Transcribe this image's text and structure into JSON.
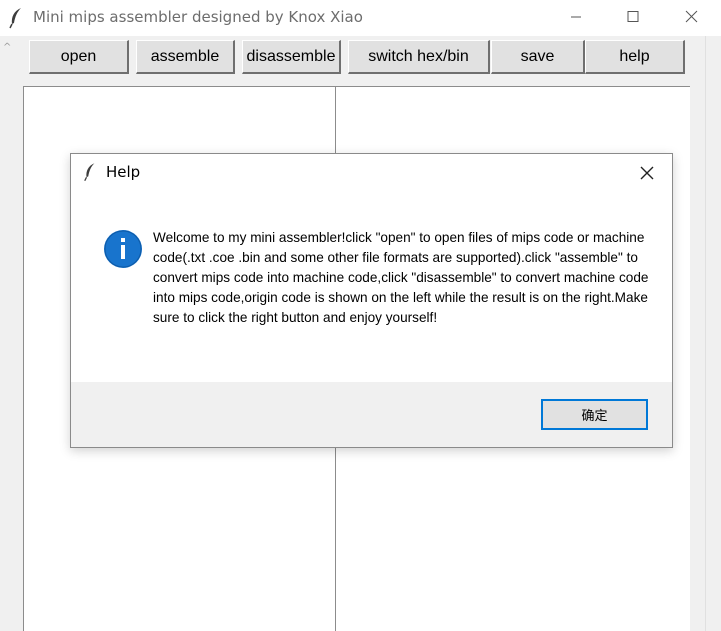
{
  "window": {
    "title": "Mini mips assembler designed by Knox Xiao",
    "controls": {
      "minimize_icon": "minimize-icon",
      "maximize_icon": "maximize-icon",
      "close_icon": "close-icon"
    }
  },
  "toolbar": {
    "open_label": "open",
    "assemble_label": "assemble",
    "disassemble_label": "disassemble",
    "switch_label": "switch hex/bin",
    "save_label": "save",
    "help_label": "help"
  },
  "panes": {
    "left_text": "",
    "right_text": ""
  },
  "dialog": {
    "title": "Help",
    "icon": "info-icon",
    "message": "Welcome to my mini assembler!click \"open\" to open files of mips code or machine code(.txt .coe .bin and some other file formats are supported).click \"assemble\" to convert mips code into machine code,click \"disassemble\" to convert machine code into mips code,origin code is shown on the left while the result is on the right.Make sure to click the right button and enjoy yourself!",
    "ok_label": "确定"
  },
  "colors": {
    "accent": "#0078d7",
    "info_blue": "#1874cd",
    "chrome_bg": "#f0f0f0"
  }
}
